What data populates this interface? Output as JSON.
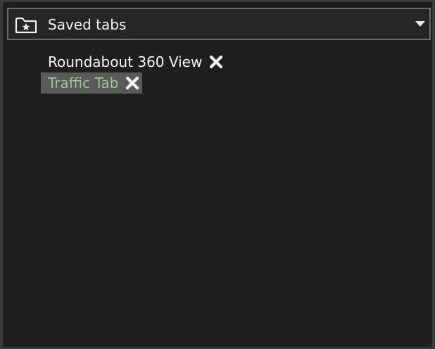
{
  "panel": {
    "title": "Saved tabs",
    "header_icon": "folder-star-icon",
    "dropdown_icon": "chevron-down-icon"
  },
  "saved_tabs": [
    {
      "label": "Roundabout 360 View",
      "selected": false,
      "close_icon": "close-icon"
    },
    {
      "label": "Traffic Tab",
      "selected": true,
      "close_icon": "close-icon"
    }
  ],
  "colors": {
    "background": "#1f1f1f",
    "header_border": "#6b6b6b",
    "selected_row": "#5a5a5a",
    "selected_text": "#9fc3a0",
    "text": "#f5f5f5"
  }
}
